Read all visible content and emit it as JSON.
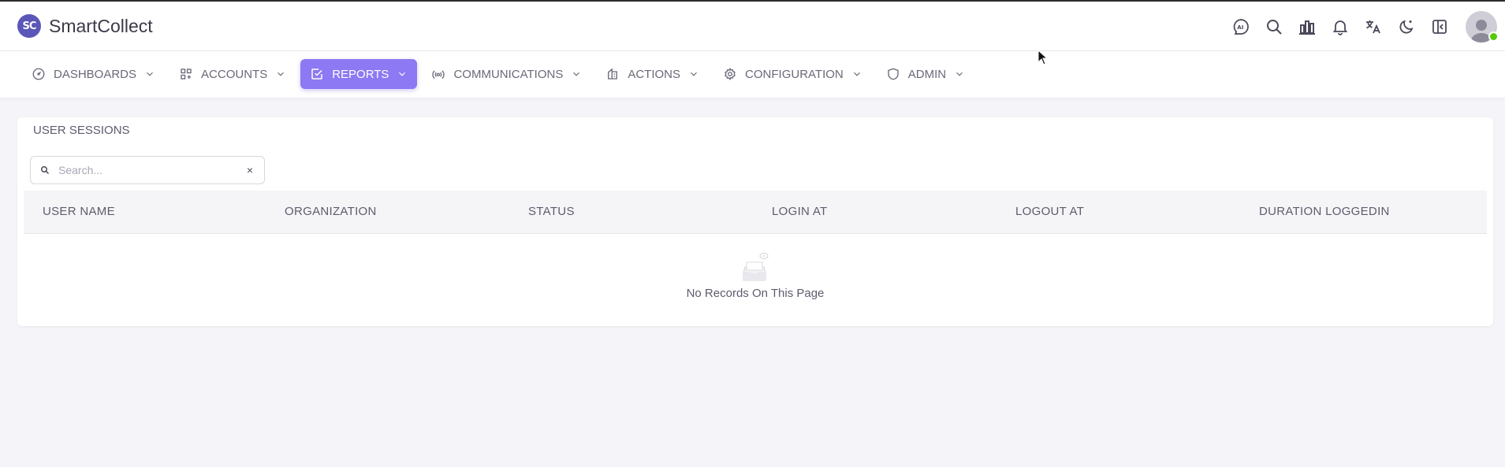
{
  "app": {
    "logo_text": "SC",
    "name": "SmartCollect"
  },
  "header_icons": [
    "ai-icon",
    "search-icon",
    "bar-chart-icon",
    "bell-icon",
    "translate-icon",
    "moon-icon",
    "sidebar-toggle-icon"
  ],
  "nav": {
    "items": [
      {
        "label": "DASHBOARDS",
        "icon": "dashboard-icon"
      },
      {
        "label": "ACCOUNTS",
        "icon": "accounts-icon"
      },
      {
        "label": "REPORTS",
        "icon": "reports-icon",
        "active": true
      },
      {
        "label": "COMMUNICATIONS",
        "icon": "broadcast-icon"
      },
      {
        "label": "ACTIONS",
        "icon": "actions-icon"
      },
      {
        "label": "CONFIGURATION",
        "icon": "gear-icon"
      },
      {
        "label": "ADMIN",
        "icon": "shield-icon"
      }
    ]
  },
  "panel": {
    "title": "USER SESSIONS",
    "search": {
      "placeholder": "Search...",
      "value": "",
      "clear": "×"
    },
    "columns": [
      "USER NAME",
      "ORGANIZATION",
      "STATUS",
      "LOGIN AT",
      "LOGOUT AT",
      "DURATION LOGGEDIN"
    ],
    "empty_message": "No Records On This Page"
  },
  "colors": {
    "brand": "#5b57b8",
    "accent": "#8c79f3",
    "online": "#56ca00",
    "background": "#f5f5f9"
  }
}
